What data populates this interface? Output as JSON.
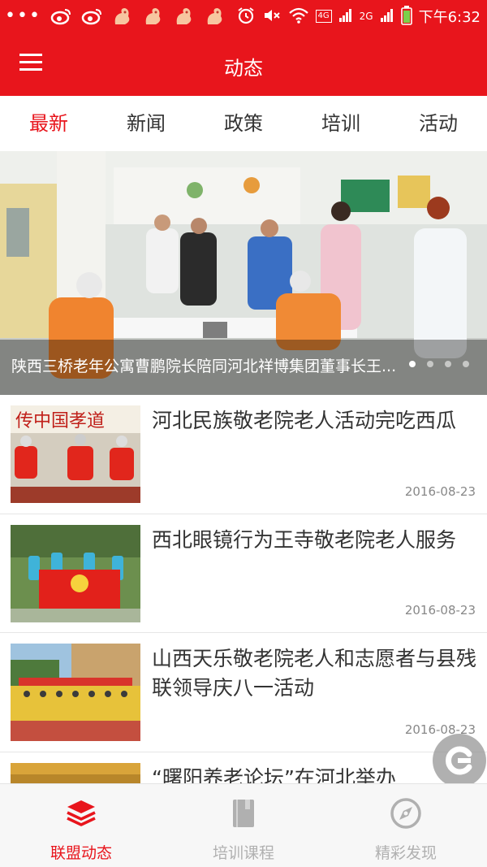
{
  "status_bar": {
    "dots": "•••",
    "network_4g": "4G",
    "network_2g": "2G",
    "time": "下午6:32",
    "icons": [
      "weibo-icon",
      "weibo-icon",
      "squirrel-icon",
      "squirrel-icon",
      "squirrel-icon",
      "squirrel-icon",
      "alarm-icon",
      "mute-icon",
      "wifi-icon",
      "signal-icon",
      "battery-icon"
    ]
  },
  "app_bar": {
    "title": "动态",
    "menu_icon": "menu-icon"
  },
  "tabs": [
    {
      "label": "最新",
      "active": true
    },
    {
      "label": "新闻",
      "active": false
    },
    {
      "label": "政策",
      "active": false
    },
    {
      "label": "培训",
      "active": false
    },
    {
      "label": "活动",
      "active": false
    }
  ],
  "banner": {
    "caption": "陕西三桥老年公寓曹鹏院长陪同河北祥博集团董事长王...",
    "active_dot": 0,
    "dot_count": 4
  },
  "news": [
    {
      "title": "河北民族敬老院老人活动完吃西瓜",
      "date": "2016-08-23",
      "thumb_text": "传中国孝道"
    },
    {
      "title": "西北眼镜行为王寺敬老院老人服务",
      "date": "2016-08-23",
      "thumb_text": ""
    },
    {
      "title": "山西天乐敬老院老人和志愿者与县残联领导庆八一活动",
      "date": "2016-08-23",
      "thumb_text": ""
    },
    {
      "title": "“曙阳养老论坛”在河北举办",
      "date": "",
      "thumb_text": ""
    }
  ],
  "bottom_nav": [
    {
      "label": "联盟动态",
      "icon": "layers-icon",
      "active": true
    },
    {
      "label": "培训课程",
      "icon": "book-icon",
      "active": false
    },
    {
      "label": "精彩发现",
      "icon": "compass-icon",
      "active": false
    }
  ],
  "colors": {
    "brand": "#e8151c",
    "inactive": "#b0b0b0"
  }
}
